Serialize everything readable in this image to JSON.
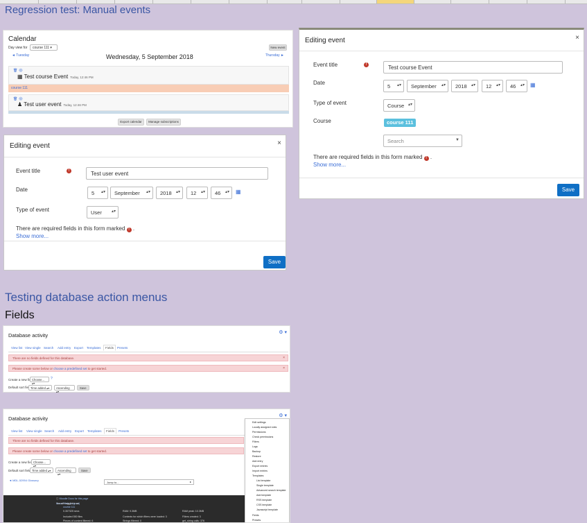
{
  "page": {
    "heading_main": "Regression test: Manual events",
    "heading_db": "Testing database action menus",
    "heading_fields": "Fields"
  },
  "calendar": {
    "title": "Calendar",
    "day_view_for_label": "Day view for",
    "course_select": "course 111",
    "new_event_button": "New event",
    "prev_day": "◄ Tuesday",
    "next_day": "Thursday ►",
    "date_heading": "Wednesday, 5 September 2018",
    "events": [
      {
        "name": "Test course Event",
        "time": "Today, 12:46 PM"
      },
      {
        "name": "Test user event",
        "time": "Today, 12:46 PM"
      }
    ],
    "course_band": "course 111",
    "export_button": "Export calendar",
    "manage_button": "Manage subscriptions"
  },
  "modal_user": {
    "title": "Editing event",
    "close": "×",
    "event_title_label": "Event title",
    "event_title_value": "Test user event",
    "date_label": "Date",
    "date_day": "5",
    "date_month": "September",
    "date_year": "2018",
    "date_hour": "12",
    "date_minute": "46",
    "type_label": "Type of event",
    "type_value": "User",
    "required_note": "There are required fields in this form marked",
    "show_more": "Show more...",
    "save": "Save"
  },
  "modal_course": {
    "title": "Editing event",
    "close": "×",
    "event_title_label": "Event title",
    "event_title_value": "Test course Event",
    "date_label": "Date",
    "date_day": "5",
    "date_month": "September",
    "date_year": "2018",
    "date_hour": "12",
    "date_minute": "46",
    "type_label": "Type of event",
    "type_value": "Course",
    "course_label": "Course",
    "course_badge": "course 111",
    "search_placeholder": "Search",
    "required_note": "There are required fields in this form marked",
    "show_more": "Show more...",
    "save": "Save"
  },
  "database": {
    "title": "Database activity",
    "tabs": [
      "View list",
      "View single",
      "Search",
      "Add entry",
      "Export",
      "Templates",
      "Fields",
      "Presets"
    ],
    "active_tab": "Fields",
    "alert_no_fields": "There are no fields defined for this database.",
    "alert_create_prefix": "Please create some below or",
    "alert_create_link": "choose a predefined set",
    "alert_create_suffix": "to get started.",
    "create_field_label": "Create a new field",
    "create_field_select": "Choose...",
    "default_sort_label": "Default sort field",
    "sort_field_select": "Time added",
    "sort_order_select": "Ascending",
    "save_button": "Save",
    "back_link": "◄ MDL-52954 Glossary",
    "jump_to": "Jump to...",
    "menu_items": [
      "Edit settings",
      "Locally assigned roles",
      "Permissions",
      "Check permissions",
      "Filters",
      "Logs",
      "Backup",
      "Restore",
      "Add entry",
      "Export entries",
      "Import entries",
      "Templates",
      "List template",
      "Single template",
      "Advanced search template",
      "Add template",
      "RSS template",
      "CSS template",
      "Javascript template",
      "Fields",
      "Presets"
    ],
    "footer": {
      "docs_link": "Moodle Docs for this page",
      "logged_in_prefix": "You are logged in as",
      "logged_in_user": "Anna Pirate",
      "logout": "(Log out)",
      "course_link": "course 111",
      "time": "0.307325 secs",
      "ram": "RAM: 9.3MB",
      "ram_peak": "RAM peak: 10.3MB",
      "included": "Included 550 files",
      "contexts": "Contexts for which filters were loaded: 3",
      "filters": "Filters created: 3",
      "pieces": "Pieces of content filtered: 6",
      "strings": "Strings filtered: 0",
      "get_string": "get_string calls: 376"
    }
  }
}
